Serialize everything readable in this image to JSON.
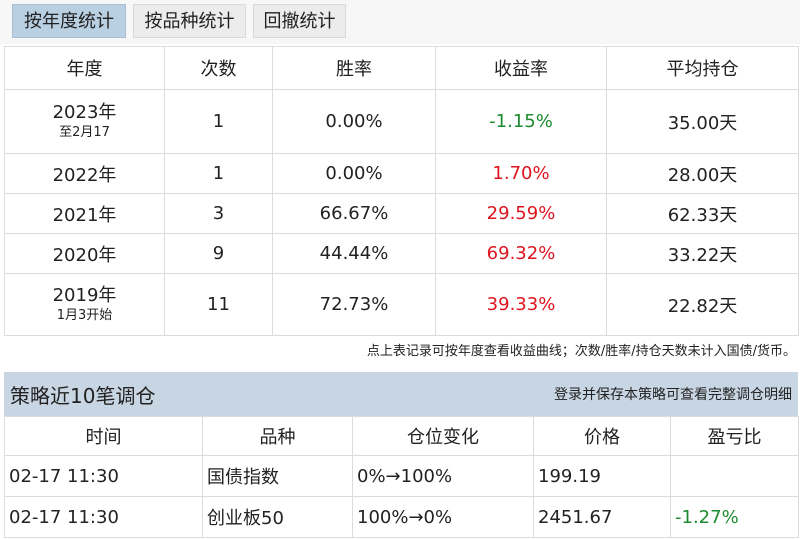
{
  "tabs": [
    {
      "label": "按年度统计",
      "active": true
    },
    {
      "label": "按品种统计",
      "active": false
    },
    {
      "label": "回撤统计",
      "active": false
    }
  ],
  "stats": {
    "headers": [
      "年度",
      "次数",
      "胜率",
      "收益率",
      "平均持仓"
    ],
    "rows": [
      {
        "year": "2023年",
        "sub": "至2月17",
        "count": "1",
        "win": "0.00%",
        "ret": "-1.15%",
        "hold": "35.00天"
      },
      {
        "year": "2022年",
        "sub": "",
        "count": "1",
        "win": "0.00%",
        "ret": "1.70%",
        "hold": "28.00天"
      },
      {
        "year": "2021年",
        "sub": "",
        "count": "3",
        "win": "66.67%",
        "ret": "29.59%",
        "hold": "62.33天"
      },
      {
        "year": "2020年",
        "sub": "",
        "count": "9",
        "win": "44.44%",
        "ret": "69.32%",
        "hold": "33.22天"
      },
      {
        "year": "2019年",
        "sub": "1月3开始",
        "count": "11",
        "win": "72.73%",
        "ret": "39.33%",
        "hold": "22.82天"
      }
    ]
  },
  "note": "点上表记录可按年度查看收益曲线；次数/胜率/持仓天数未计入国债/货币。",
  "section": {
    "title": "策略近10笔调仓",
    "link": "登录并保存本策略可查看完整调仓明细"
  },
  "trades": {
    "headers": [
      "时间",
      "品种",
      "仓位变化",
      "价格",
      "盈亏比"
    ],
    "rows": [
      {
        "time": "02-17 11:30",
        "item": "国债指数",
        "change": "0%→100%",
        "price": "199.19",
        "pl": ""
      },
      {
        "time": "02-17 11:30",
        "item": "创业板50",
        "change": "100%→0%",
        "price": "2451.67",
        "pl": "-1.27%"
      }
    ]
  },
  "colors": {
    "negative": "#1c8a2e",
    "positive": "#e0141e",
    "tab_active": "#b9cfe2",
    "section_bar": "#c8d6e4"
  }
}
